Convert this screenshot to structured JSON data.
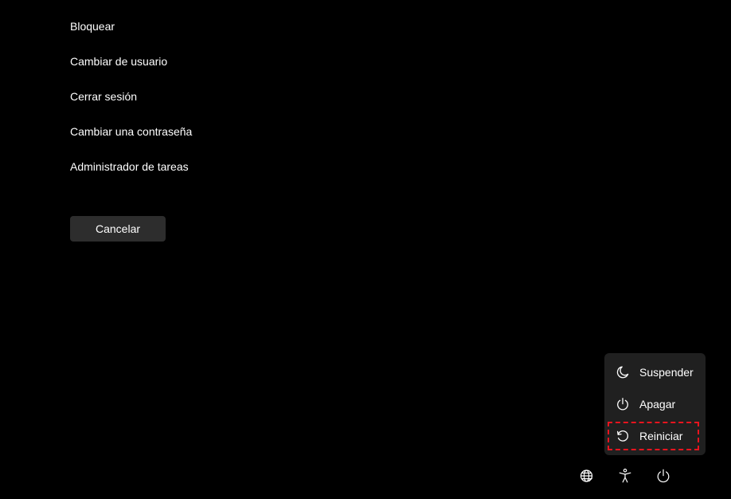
{
  "security_options": [
    {
      "id": "lock",
      "label": "Bloquear"
    },
    {
      "id": "switch-user",
      "label": "Cambiar de usuario"
    },
    {
      "id": "sign-out",
      "label": "Cerrar sesión"
    },
    {
      "id": "change-password",
      "label": "Cambiar una contraseña"
    },
    {
      "id": "task-manager",
      "label": "Administrador de tareas"
    }
  ],
  "cancel_label": "Cancelar",
  "power_menu": {
    "items": [
      {
        "id": "sleep",
        "label": "Suspender",
        "icon": "moon-icon"
      },
      {
        "id": "shutdown",
        "label": "Apagar",
        "icon": "power-icon"
      },
      {
        "id": "restart",
        "label": "Reiniciar",
        "icon": "restart-icon",
        "highlighted": true
      }
    ]
  },
  "bottom_icons": [
    {
      "id": "network",
      "icon": "network-icon"
    },
    {
      "id": "accessibility",
      "icon": "accessibility-icon"
    },
    {
      "id": "power",
      "icon": "power-icon"
    }
  ],
  "colors": {
    "background": "#000000",
    "button": "#2d2d2d",
    "menu": "#202020",
    "highlight_border": "#e8141e"
  }
}
